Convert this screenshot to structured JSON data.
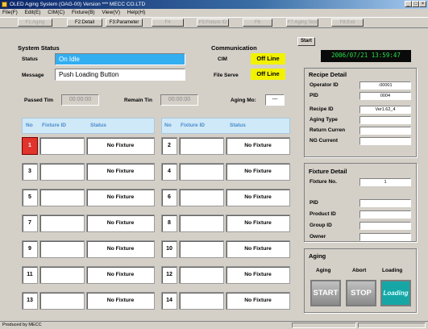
{
  "window": {
    "title": "OLED Aging System (OAG-00) Version ***   MECC CO.LTD",
    "min": "_",
    "max": "□",
    "close": "×"
  },
  "menu": [
    "File(F)",
    "Edit(E)",
    "CIM(C)",
    "Fixture(B)",
    "View(V)",
    "Help(H)"
  ],
  "toolbar": {
    "buttons": [
      {
        "label": "F1:Aging",
        "enabled": false
      },
      {
        "label": "F2:Detail",
        "enabled": true
      },
      {
        "label": "F3:Parameter",
        "enabled": true
      },
      {
        "label": "F4",
        "enabled": false
      },
      {
        "label": "F5:Fixture ID",
        "enabled": false
      },
      {
        "label": "F6",
        "enabled": false
      },
      {
        "label": "F7:Aging Test",
        "enabled": false
      },
      {
        "label": "F8:Exit",
        "enabled": false
      }
    ]
  },
  "system_status": {
    "title": "System Status",
    "status_label": "Status",
    "status_value": "On Idle",
    "message_label": "Message",
    "message_value": "Push Loading Button"
  },
  "communication": {
    "title": "Communication",
    "cim_label": "CIM",
    "cim_value": "Off Line",
    "file_label": "File Serve",
    "file_value": "Off Line"
  },
  "start_label": "Start",
  "clock": "2006/07/21 13:59:47",
  "timers": {
    "passed_label": "Passed Tim",
    "passed_value": "00:00:00",
    "remain_label": "Remain Tin",
    "remain_value": "00:00:00",
    "aging_mode_label": "Aging Mo:",
    "aging_mode_value": "---"
  },
  "grid": {
    "headers": {
      "no": "No",
      "fixture": "Fixture ID",
      "status": "Status"
    },
    "left": [
      {
        "no": "1",
        "fixture": "",
        "status": "No Fixture",
        "selected": true
      },
      {
        "no": "3",
        "fixture": "",
        "status": "No Fixture"
      },
      {
        "no": "5",
        "fixture": "",
        "status": "No Fixture"
      },
      {
        "no": "7",
        "fixture": "",
        "status": "No Fixture"
      },
      {
        "no": "9",
        "fixture": "",
        "status": "No Fixture"
      },
      {
        "no": "11",
        "fixture": "",
        "status": "No Fixture"
      },
      {
        "no": "13",
        "fixture": "",
        "status": "No Fixture"
      }
    ],
    "right": [
      {
        "no": "2",
        "fixture": "",
        "status": "No Fixture"
      },
      {
        "no": "4",
        "fixture": "",
        "status": "No Fixture"
      },
      {
        "no": "6",
        "fixture": "",
        "status": "No Fixture"
      },
      {
        "no": "8",
        "fixture": "",
        "status": "No Fixture"
      },
      {
        "no": "10",
        "fixture": "",
        "status": "No Fixture"
      },
      {
        "no": "12",
        "fixture": "",
        "status": "No Fixture"
      },
      {
        "no": "14",
        "fixture": "",
        "status": "No Fixture"
      }
    ]
  },
  "recipe": {
    "title": "Recipe Detail",
    "fields": [
      {
        "label": "Operator ID",
        "value": "-00001"
      },
      {
        "label": "PID",
        "value": "0004"
      },
      {
        "label": "Recipe ID",
        "value": "Ver1.62_4"
      },
      {
        "label": "Aging Type",
        "value": ""
      },
      {
        "label": "Return Curren",
        "value": ""
      },
      {
        "label": "NG Current",
        "value": ""
      }
    ]
  },
  "fixture": {
    "title": "Fixture Detail",
    "fields": [
      {
        "label": "Fixture No.",
        "value": "1"
      },
      {
        "label": "PID",
        "value": ""
      },
      {
        "label": "Product ID",
        "value": ""
      },
      {
        "label": "Group ID",
        "value": ""
      },
      {
        "label": "Owner",
        "value": ""
      }
    ]
  },
  "aging": {
    "title": "Aging",
    "col_aging": "Aging",
    "col_abort": "Abort",
    "col_loading": "Loading",
    "start": "START",
    "stop": "STOP",
    "loading": "Loading"
  },
  "statusbar": "Produced by MECC",
  "colors": {
    "status_blue": "#33aef0",
    "offline_yellow": "#f2f200",
    "selected_red": "#e0342c",
    "clock_green": "#27e04a",
    "loading_teal": "#16a6a6"
  }
}
